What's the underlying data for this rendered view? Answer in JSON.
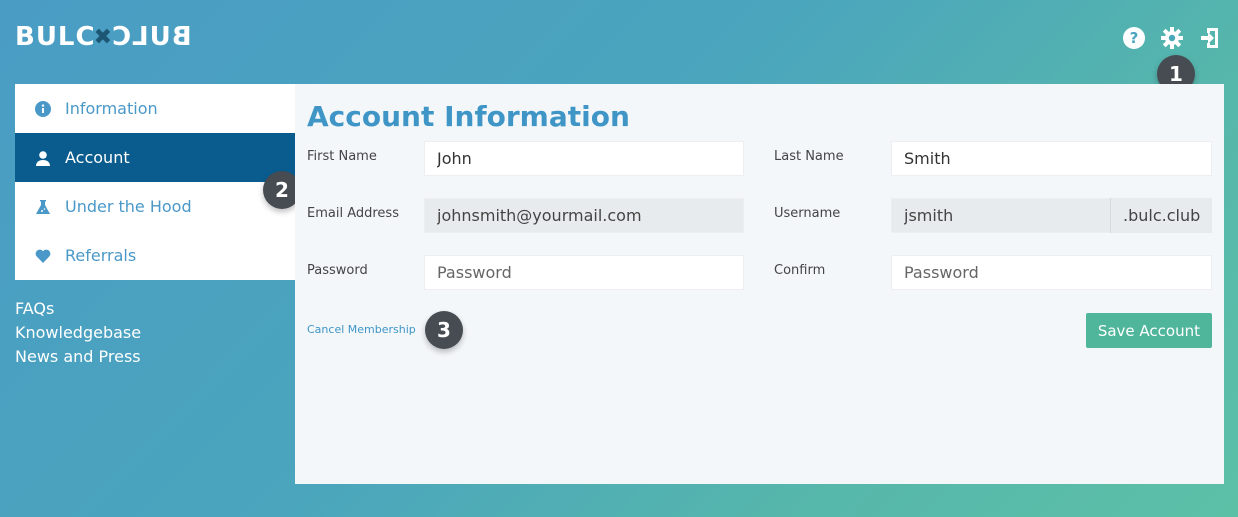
{
  "header": {
    "logo_left": "BULC",
    "logo_mid": "✖",
    "logo_right": "BULC",
    "icons": [
      "help-icon",
      "gear-icon",
      "logout-icon"
    ]
  },
  "badges": [
    "1",
    "2",
    "3"
  ],
  "sidebar": {
    "items": [
      {
        "label": "Information",
        "icon": "info-icon",
        "active": false
      },
      {
        "label": "Account",
        "icon": "user-icon",
        "active": true
      },
      {
        "label": "Under the Hood",
        "icon": "flask-icon",
        "active": false
      },
      {
        "label": "Referrals",
        "icon": "heart-icon",
        "active": false
      }
    ],
    "links": [
      "FAQs",
      "Knowledgebase",
      "News and Press"
    ]
  },
  "main": {
    "title": "Account Information",
    "fields": {
      "first_name": {
        "label": "First Name",
        "value": "John"
      },
      "last_name": {
        "label": "Last Name",
        "value": "Smith"
      },
      "email": {
        "label": "Email Address",
        "value": "johnsmith@yourmail.com"
      },
      "username": {
        "label": "Username",
        "value": "jsmith",
        "suffix": ".bulc.club"
      },
      "password": {
        "label": "Password",
        "placeholder": "Password"
      },
      "confirm": {
        "label": "Confirm",
        "placeholder": "Password"
      }
    },
    "cancel_label": "Cancel Membership",
    "save_label": "Save Account"
  },
  "colors": {
    "accent": "#3f96c6",
    "active_nav": "#0a5c8f",
    "save_button": "#4fb59b",
    "badge": "#474c53"
  }
}
